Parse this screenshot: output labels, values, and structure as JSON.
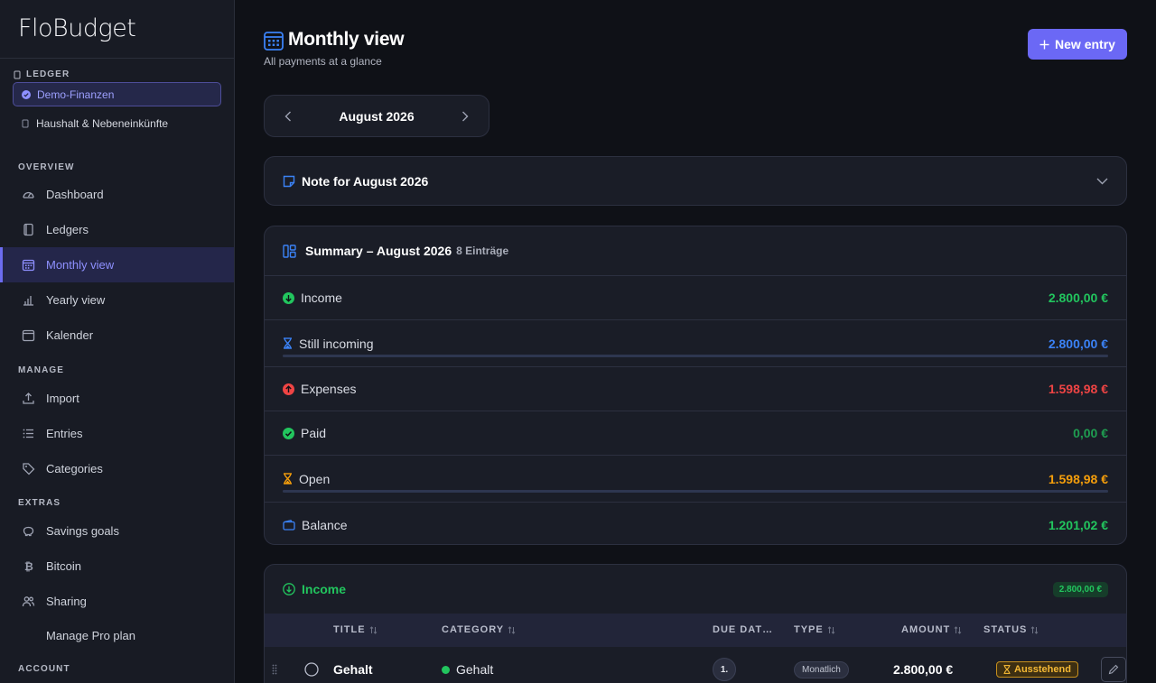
{
  "app": {
    "brand": "FloBudget"
  },
  "sidebar": {
    "ledger_heading": "LEDGER",
    "ledgers": [
      {
        "label": "Demo-Finanzen",
        "active": true
      },
      {
        "label": "Haushalt & Nebeneinkünfte",
        "active": false
      }
    ],
    "sections": {
      "overview": "OVERVIEW",
      "manage": "MANAGE",
      "extras": "EXTRAS",
      "account": "ACCOUNT"
    },
    "items": {
      "dashboard": "Dashboard",
      "ledgers": "Ledgers",
      "monthly": "Monthly view",
      "yearly": "Yearly view",
      "calendar": "Kalender",
      "import": "Import",
      "entries": "Entries",
      "categories": "Categories",
      "savings": "Savings goals",
      "bitcoin": "Bitcoin",
      "sharing": "Sharing",
      "pro": "Manage Pro plan"
    }
  },
  "header": {
    "title": "Monthly view",
    "subtitle": "All payments at a glance",
    "new_entry": "New entry"
  },
  "month_nav": {
    "label": "August 2026"
  },
  "note": {
    "title": "Note for August 2026"
  },
  "summary": {
    "title": "Summary – August 2026",
    "count": "8 Einträge",
    "rows": {
      "income": {
        "label": "Income",
        "value": "2.800,00 €"
      },
      "still_incoming": {
        "label": "Still incoming",
        "value": "2.800,00 €",
        "progress": 1.0
      },
      "expenses": {
        "label": "Expenses",
        "value": "1.598,98 €"
      },
      "paid": {
        "label": "Paid",
        "value": "0,00 €"
      },
      "open": {
        "label": "Open",
        "value": "1.598,98 €",
        "progress": 1.0
      },
      "balance": {
        "label": "Balance",
        "value": "1.201,02 €"
      }
    }
  },
  "income_section": {
    "title": "Income",
    "total": "2.800,00 €",
    "columns": {
      "title": "TITLE",
      "category": "CATEGORY",
      "due": "DUE DAT…",
      "type": "TYPE",
      "amount": "AMOUNT",
      "status": "STATUS"
    },
    "rows": [
      {
        "title": "Gehalt",
        "category": "Gehalt",
        "due": "1.",
        "type": "Monatlich",
        "amount": "2.800,00 €",
        "status": "Ausstehend"
      }
    ]
  },
  "colors": {
    "accent": "#6b68f5",
    "green": "#22c55e",
    "blue": "#3b82f6",
    "red": "#ef4444",
    "amber": "#f59e0b"
  }
}
